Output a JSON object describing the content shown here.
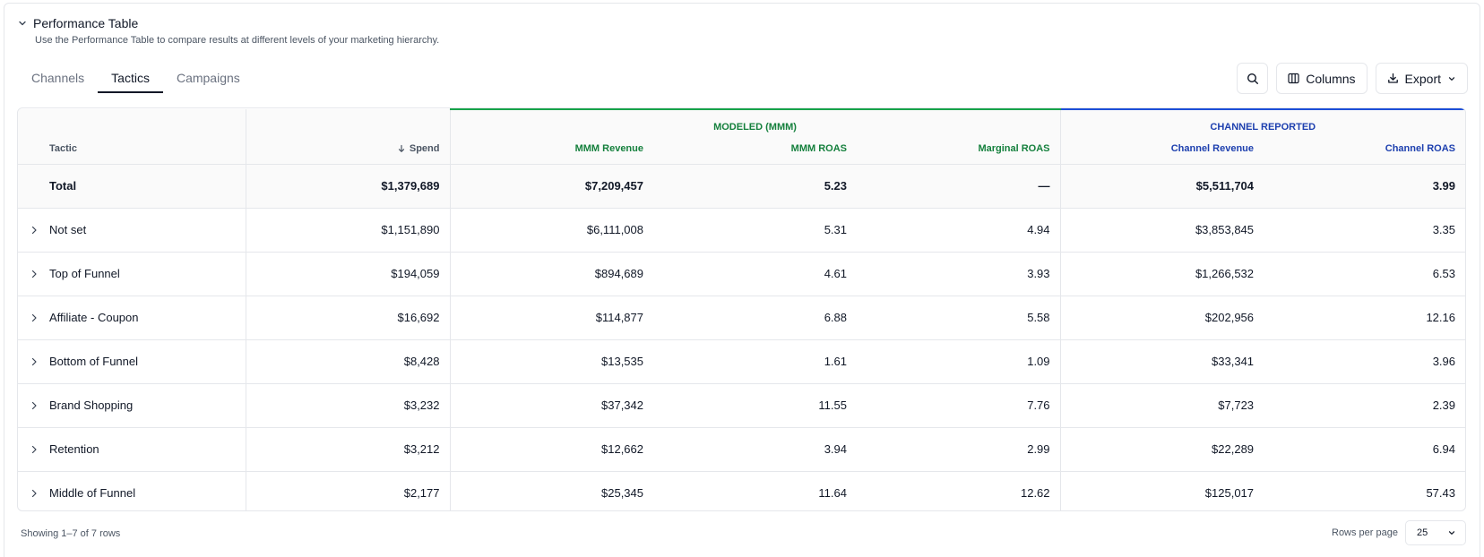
{
  "header": {
    "title": "Performance Table",
    "subtitle": "Use the Performance Table to compare results at different levels of your marketing hierarchy."
  },
  "tabs": [
    {
      "label": "Channels",
      "active": false
    },
    {
      "label": "Tactics",
      "active": true
    },
    {
      "label": "Campaigns",
      "active": false
    }
  ],
  "toolbar": {
    "search_icon": "search-icon",
    "columns_label": "Columns",
    "export_label": "Export"
  },
  "table": {
    "groups": {
      "modeled": "MODELED (MMM)",
      "reported": "CHANNEL REPORTED"
    },
    "columns": {
      "tactic": "Tactic",
      "spend": "Spend",
      "mmm_revenue": "MMM Revenue",
      "mmm_roas": "MMM ROAS",
      "marginal_roas": "Marginal ROAS",
      "channel_revenue": "Channel Revenue",
      "channel_roas": "Channel ROAS"
    },
    "total": {
      "name": "Total",
      "spend": "$1,379,689",
      "mmm_revenue": "$7,209,457",
      "mmm_roas": "5.23",
      "marginal_roas": "—",
      "channel_revenue": "$5,511,704",
      "channel_roas": "3.99"
    },
    "rows": [
      {
        "name": "Not set",
        "spend": "$1,151,890",
        "mmm_revenue": "$6,111,008",
        "mmm_roas": "5.31",
        "marginal_roas": "4.94",
        "channel_revenue": "$3,853,845",
        "channel_roas": "3.35"
      },
      {
        "name": "Top of Funnel",
        "spend": "$194,059",
        "mmm_revenue": "$894,689",
        "mmm_roas": "4.61",
        "marginal_roas": "3.93",
        "channel_revenue": "$1,266,532",
        "channel_roas": "6.53"
      },
      {
        "name": "Affiliate - Coupon",
        "spend": "$16,692",
        "mmm_revenue": "$114,877",
        "mmm_roas": "6.88",
        "marginal_roas": "5.58",
        "channel_revenue": "$202,956",
        "channel_roas": "12.16"
      },
      {
        "name": "Bottom of Funnel",
        "spend": "$8,428",
        "mmm_revenue": "$13,535",
        "mmm_roas": "1.61",
        "marginal_roas": "1.09",
        "channel_revenue": "$33,341",
        "channel_roas": "3.96"
      },
      {
        "name": "Brand Shopping",
        "spend": "$3,232",
        "mmm_revenue": "$37,342",
        "mmm_roas": "11.55",
        "marginal_roas": "7.76",
        "channel_revenue": "$7,723",
        "channel_roas": "2.39"
      },
      {
        "name": "Retention",
        "spend": "$3,212",
        "mmm_revenue": "$12,662",
        "mmm_roas": "3.94",
        "marginal_roas": "2.99",
        "channel_revenue": "$22,289",
        "channel_roas": "6.94"
      },
      {
        "name": "Middle of Funnel",
        "spend": "$2,177",
        "mmm_revenue": "$25,345",
        "mmm_roas": "11.64",
        "marginal_roas": "12.62",
        "channel_revenue": "$125,017",
        "channel_roas": "57.43"
      }
    ]
  },
  "footer": {
    "showing": "Showing 1–7 of 7 rows",
    "rows_per_page_label": "Rows per page",
    "rows_per_page_value": "25"
  },
  "colors": {
    "modeled_accent": "#16a34a",
    "reported_accent": "#1d4ed8"
  }
}
